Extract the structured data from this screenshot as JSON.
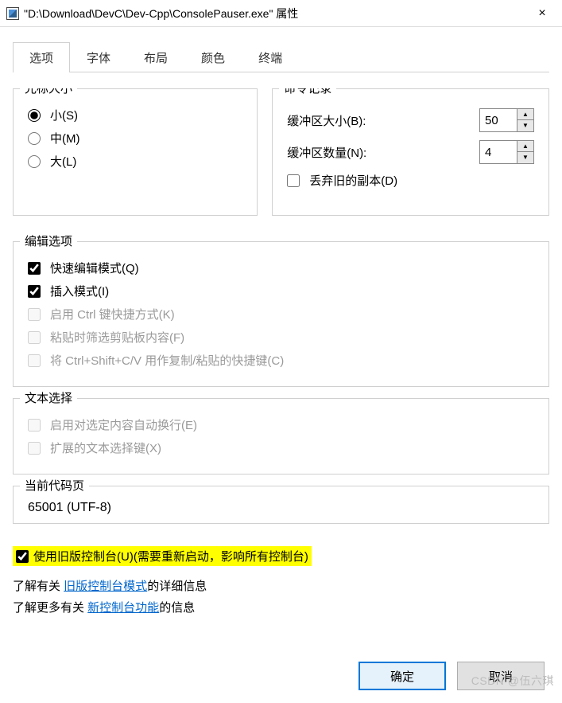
{
  "titlebar": {
    "text": "\"D:\\Download\\DevC\\Dev-Cpp\\ConsolePauser.exe\" 属性",
    "close": "×"
  },
  "tabs": [
    "选项",
    "字体",
    "布局",
    "颜色",
    "终端"
  ],
  "cursor": {
    "legend": "光标大小",
    "small": "小(S)",
    "medium": "中(M)",
    "large": "大(L)"
  },
  "cmd": {
    "legend": "命令记录",
    "buf_size": "缓冲区大小(B):",
    "buf_size_val": "50",
    "buf_count": "缓冲区数量(N):",
    "buf_count_val": "4",
    "discard": "丢弃旧的副本(D)"
  },
  "edit": {
    "legend": "编辑选项",
    "quick": "快速编辑模式(Q)",
    "insert": "插入模式(I)",
    "ctrl": "启用 Ctrl 键快捷方式(K)",
    "paste_filter": "粘贴时筛选剪贴板内容(F)",
    "ctrl_shift": "将 Ctrl+Shift+C/V 用作复制/粘贴的快捷键(C)"
  },
  "textsel": {
    "legend": "文本选择",
    "wrap": "启用对选定内容自动换行(E)",
    "ext": "扩展的文本选择键(X)"
  },
  "codepage": {
    "legend": "当前代码页",
    "value": "65001 (UTF-8)"
  },
  "legacy": {
    "label": "使用旧版控制台(U)(需要重新启动，影响所有控制台)",
    "info1_pre": "了解有关 ",
    "info1_link": "旧版控制台模式",
    "info1_post": "的详细信息",
    "info2_pre": "了解更多有关 ",
    "info2_link": "新控制台功能",
    "info2_post": "的信息"
  },
  "footer": {
    "ok": "确定",
    "cancel": "取消"
  },
  "watermark": "CSDN @伍六琪"
}
